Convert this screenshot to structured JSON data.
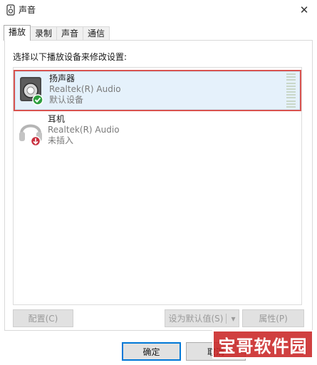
{
  "window": {
    "title": "声音"
  },
  "tabs": [
    {
      "label": "播放",
      "active": true
    },
    {
      "label": "录制",
      "active": false
    },
    {
      "label": "声音",
      "active": false
    },
    {
      "label": "通信",
      "active": false
    }
  ],
  "instruction": "选择以下播放设备来修改设置:",
  "devices": [
    {
      "name": "扬声器",
      "driver": "Realtek(R) Audio",
      "status": "默认设备",
      "icon": "speaker-icon",
      "badge": "default-check-icon",
      "selected": true
    },
    {
      "name": "耳机",
      "driver": "Realtek(R) Audio",
      "status": "未插入",
      "icon": "headphones-icon",
      "badge": "unplugged-arrow-icon",
      "selected": false
    }
  ],
  "panel_buttons": {
    "configure": "配置(C)",
    "set_default": "设为默认值(S)",
    "set_default_arrow": "▾",
    "properties": "属性(P)"
  },
  "dialog_buttons": {
    "ok": "确定",
    "cancel": "取消"
  },
  "watermark": "宝哥软件园",
  "colors": {
    "selection_border": "#d9534f",
    "selection_fill": "#e5f1fb",
    "default_badge": "#2e9e3e",
    "unplugged_badge": "#c9303f",
    "watermark": "#c81e1e"
  }
}
